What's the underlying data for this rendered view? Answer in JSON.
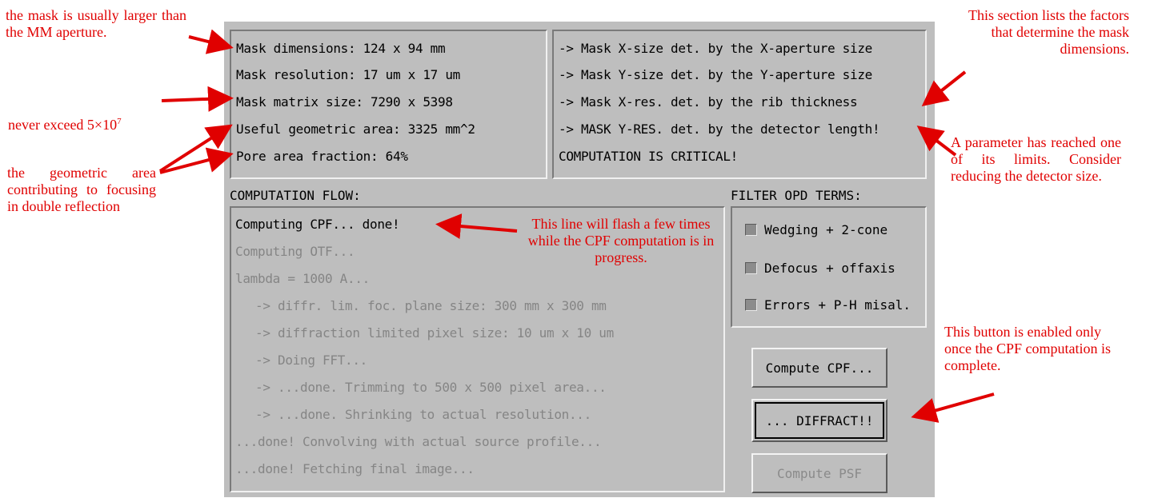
{
  "mask_info": {
    "lines": [
      "Mask dimensions: 124 x 94 mm",
      "Mask resolution: 17 um x 17 um",
      "Mask matrix size: 7290 x 5398",
      "Useful geometric area: 3325 mm^2",
      "Pore area fraction: 64%"
    ]
  },
  "factors": {
    "lines": [
      "-> Mask X-size det. by the X-aperture size",
      "-> Mask Y-size det. by the Y-aperture size",
      "-> Mask X-res. det. by the rib thickness",
      "-> MASK Y-RES. det. by the detector length!",
      "COMPUTATION IS CRITICAL!"
    ]
  },
  "flow": {
    "title": "COMPUTATION FLOW:",
    "lines": [
      "Computing CPF... done!",
      "Computing OTF...",
      "lambda = 1000 A...",
      "-> diffr. lim. foc. plane size: 300 mm x 300 mm",
      "-> diffraction limited pixel size: 10 um x 10 um",
      "-> Doing FFT...",
      "-> ...done. Trimming to 500 x 500 pixel area...",
      "-> ...done. Shrinking to actual resolution...",
      "...done! Convolving with actual source profile...",
      "...done! Fetching final image..."
    ]
  },
  "filter": {
    "title": "FILTER OPD TERMS:",
    "options": [
      {
        "label": "Wedging + 2-cone"
      },
      {
        "label": "Defocus + offaxis"
      },
      {
        "label": "Errors + P-H misal."
      }
    ]
  },
  "buttons": {
    "compute_cpf": "Compute CPF...",
    "diffract": "... DIFFRACT!!",
    "compute_psf": "Compute PSF"
  },
  "annotations": {
    "mask_larger": "the mask is usually larger than the MM aperture.",
    "never_exceed": "never exceed 5×10",
    "never_exceed_sup": "7",
    "geometric_area": "the geometric area contributing to focusing in double reflection",
    "section_lists": "This section lists the factors that determine the mask dimensions.",
    "parameter_limit": "A parameter has reached one of its limits. Consider reducing the detector size.",
    "flash_line": "This line will flash a few times while the CPF computation is in progress.",
    "button_enabled": "This button is enabled only once the CPF computation is complete."
  },
  "colors": {
    "annotation": "#e00000",
    "panel": "#bebebe",
    "disabled_text": "#858585"
  }
}
